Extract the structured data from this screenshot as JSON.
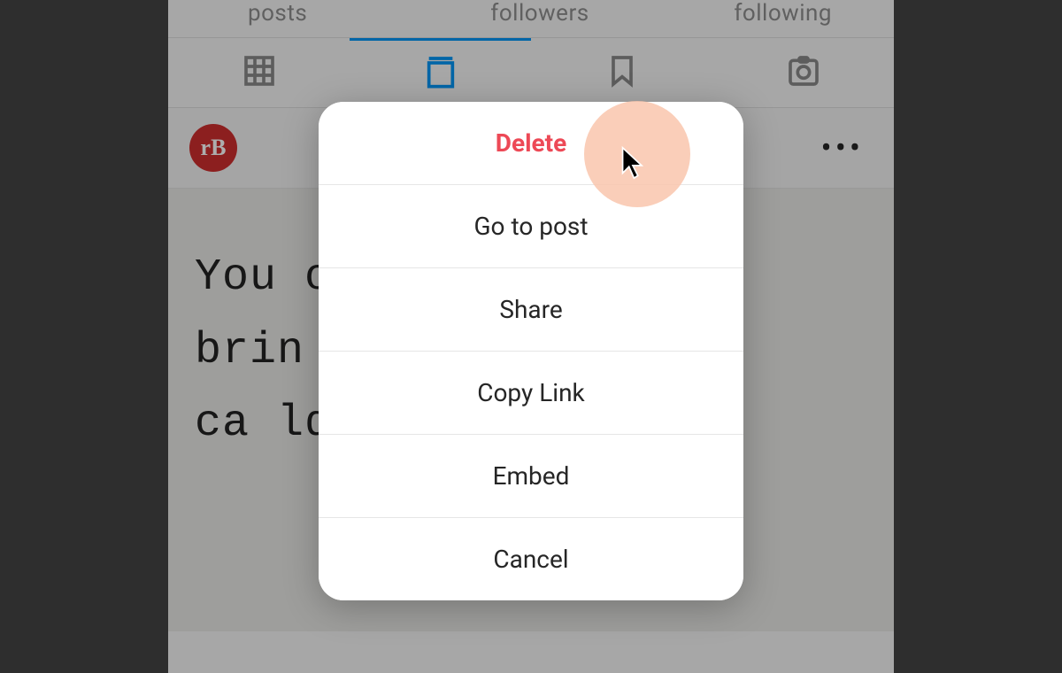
{
  "stats": {
    "posts_label": "posts",
    "followers_label": "followers",
    "following_label": "following"
  },
  "tabs": {
    "grid": "grid-icon",
    "feed": "feed-icon",
    "saved": "bookmark-icon",
    "tagged": "tagged-icon"
  },
  "post": {
    "avatar_text": "rB",
    "more_glyph": "•••",
    "body_line1": "You                               ould",
    "body_line2": "brin                               ners",
    "body_line3": "  ca                                 ld"
  },
  "action_sheet": {
    "items": [
      {
        "label": "Delete",
        "danger": true
      },
      {
        "label": "Go to post",
        "danger": false
      },
      {
        "label": "Share",
        "danger": false
      },
      {
        "label": "Copy Link",
        "danger": false
      },
      {
        "label": "Embed",
        "danger": false
      },
      {
        "label": "Cancel",
        "danger": false
      }
    ]
  },
  "colors": {
    "accent": "#0095f6",
    "danger": "#ed4956",
    "avatar_bg": "#cf2e2e"
  }
}
